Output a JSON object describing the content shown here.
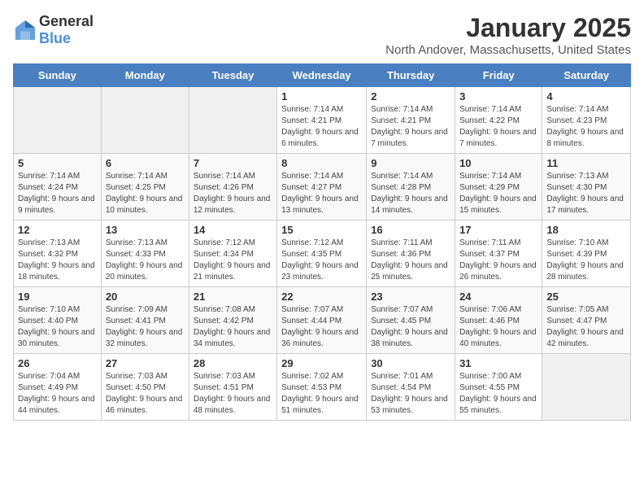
{
  "header": {
    "logo_general": "General",
    "logo_blue": "Blue",
    "month": "January 2025",
    "location": "North Andover, Massachusetts, United States"
  },
  "days_of_week": [
    "Sunday",
    "Monday",
    "Tuesday",
    "Wednesday",
    "Thursday",
    "Friday",
    "Saturday"
  ],
  "weeks": [
    [
      {
        "day": "",
        "info": ""
      },
      {
        "day": "",
        "info": ""
      },
      {
        "day": "",
        "info": ""
      },
      {
        "day": "1",
        "info": "Sunrise: 7:14 AM\nSunset: 4:21 PM\nDaylight: 9 hours and 6 minutes."
      },
      {
        "day": "2",
        "info": "Sunrise: 7:14 AM\nSunset: 4:21 PM\nDaylight: 9 hours and 7 minutes."
      },
      {
        "day": "3",
        "info": "Sunrise: 7:14 AM\nSunset: 4:22 PM\nDaylight: 9 hours and 7 minutes."
      },
      {
        "day": "4",
        "info": "Sunrise: 7:14 AM\nSunset: 4:23 PM\nDaylight: 9 hours and 8 minutes."
      }
    ],
    [
      {
        "day": "5",
        "info": "Sunrise: 7:14 AM\nSunset: 4:24 PM\nDaylight: 9 hours and 9 minutes."
      },
      {
        "day": "6",
        "info": "Sunrise: 7:14 AM\nSunset: 4:25 PM\nDaylight: 9 hours and 10 minutes."
      },
      {
        "day": "7",
        "info": "Sunrise: 7:14 AM\nSunset: 4:26 PM\nDaylight: 9 hours and 12 minutes."
      },
      {
        "day": "8",
        "info": "Sunrise: 7:14 AM\nSunset: 4:27 PM\nDaylight: 9 hours and 13 minutes."
      },
      {
        "day": "9",
        "info": "Sunrise: 7:14 AM\nSunset: 4:28 PM\nDaylight: 9 hours and 14 minutes."
      },
      {
        "day": "10",
        "info": "Sunrise: 7:14 AM\nSunset: 4:29 PM\nDaylight: 9 hours and 15 minutes."
      },
      {
        "day": "11",
        "info": "Sunrise: 7:13 AM\nSunset: 4:30 PM\nDaylight: 9 hours and 17 minutes."
      }
    ],
    [
      {
        "day": "12",
        "info": "Sunrise: 7:13 AM\nSunset: 4:32 PM\nDaylight: 9 hours and 18 minutes."
      },
      {
        "day": "13",
        "info": "Sunrise: 7:13 AM\nSunset: 4:33 PM\nDaylight: 9 hours and 20 minutes."
      },
      {
        "day": "14",
        "info": "Sunrise: 7:12 AM\nSunset: 4:34 PM\nDaylight: 9 hours and 21 minutes."
      },
      {
        "day": "15",
        "info": "Sunrise: 7:12 AM\nSunset: 4:35 PM\nDaylight: 9 hours and 23 minutes."
      },
      {
        "day": "16",
        "info": "Sunrise: 7:11 AM\nSunset: 4:36 PM\nDaylight: 9 hours and 25 minutes."
      },
      {
        "day": "17",
        "info": "Sunrise: 7:11 AM\nSunset: 4:37 PM\nDaylight: 9 hours and 26 minutes."
      },
      {
        "day": "18",
        "info": "Sunrise: 7:10 AM\nSunset: 4:39 PM\nDaylight: 9 hours and 28 minutes."
      }
    ],
    [
      {
        "day": "19",
        "info": "Sunrise: 7:10 AM\nSunset: 4:40 PM\nDaylight: 9 hours and 30 minutes."
      },
      {
        "day": "20",
        "info": "Sunrise: 7:09 AM\nSunset: 4:41 PM\nDaylight: 9 hours and 32 minutes."
      },
      {
        "day": "21",
        "info": "Sunrise: 7:08 AM\nSunset: 4:42 PM\nDaylight: 9 hours and 34 minutes."
      },
      {
        "day": "22",
        "info": "Sunrise: 7:07 AM\nSunset: 4:44 PM\nDaylight: 9 hours and 36 minutes."
      },
      {
        "day": "23",
        "info": "Sunrise: 7:07 AM\nSunset: 4:45 PM\nDaylight: 9 hours and 38 minutes."
      },
      {
        "day": "24",
        "info": "Sunrise: 7:06 AM\nSunset: 4:46 PM\nDaylight: 9 hours and 40 minutes."
      },
      {
        "day": "25",
        "info": "Sunrise: 7:05 AM\nSunset: 4:47 PM\nDaylight: 9 hours and 42 minutes."
      }
    ],
    [
      {
        "day": "26",
        "info": "Sunrise: 7:04 AM\nSunset: 4:49 PM\nDaylight: 9 hours and 44 minutes."
      },
      {
        "day": "27",
        "info": "Sunrise: 7:03 AM\nSunset: 4:50 PM\nDaylight: 9 hours and 46 minutes."
      },
      {
        "day": "28",
        "info": "Sunrise: 7:03 AM\nSunset: 4:51 PM\nDaylight: 9 hours and 48 minutes."
      },
      {
        "day": "29",
        "info": "Sunrise: 7:02 AM\nSunset: 4:53 PM\nDaylight: 9 hours and 51 minutes."
      },
      {
        "day": "30",
        "info": "Sunrise: 7:01 AM\nSunset: 4:54 PM\nDaylight: 9 hours and 53 minutes."
      },
      {
        "day": "31",
        "info": "Sunrise: 7:00 AM\nSunset: 4:55 PM\nDaylight: 9 hours and 55 minutes."
      },
      {
        "day": "",
        "info": ""
      }
    ]
  ]
}
